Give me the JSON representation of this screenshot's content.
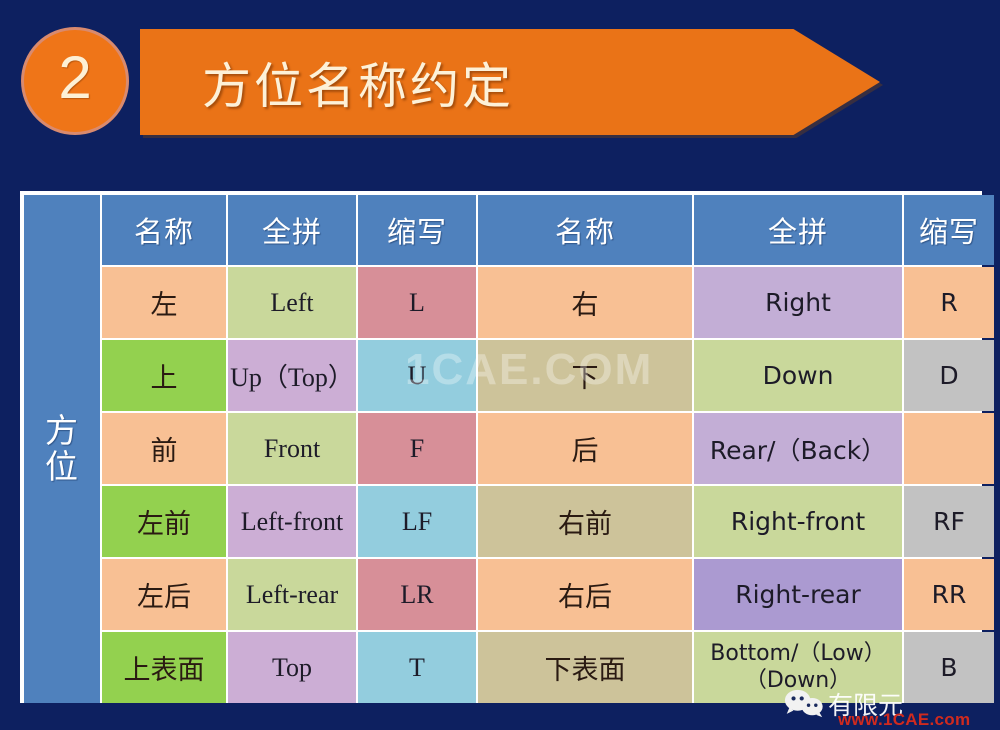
{
  "slide": {
    "background_color": "#0d2060",
    "badge_number": "2",
    "badge_color": "#ef7518",
    "banner_title": "方位名称约定",
    "banner_color": "#ea7317",
    "title_color": "#fdf1d8"
  },
  "table": {
    "row_label": "方位",
    "header_color": "#4f81bd",
    "headers": [
      "名称",
      "全拼",
      "缩写",
      "名称",
      "全拼",
      "缩写"
    ],
    "rows": [
      {
        "left_name": "左",
        "left_full": "Left",
        "left_abbr": "L",
        "right_name": "右",
        "right_full": "Right",
        "right_abbr": "R"
      },
      {
        "left_name": "上",
        "left_full": "Up（Top）",
        "left_abbr": "U",
        "right_name": "下",
        "right_full": "Down",
        "right_abbr": "D"
      },
      {
        "left_name": "前",
        "left_full": "Front",
        "left_abbr": "F",
        "right_name": "后",
        "right_full": "Rear/（Back）",
        "right_abbr": ""
      },
      {
        "left_name": "左前",
        "left_full": "Left-front",
        "left_abbr": "LF",
        "right_name": "右前",
        "right_full": "Right-front",
        "right_abbr": "RF"
      },
      {
        "left_name": "左后",
        "left_full": "Left-rear",
        "left_abbr": "LR",
        "right_name": "右后",
        "right_full": "Right-rear",
        "right_abbr": "RR"
      },
      {
        "left_name": "上表面",
        "left_full": "Top",
        "left_abbr": "T",
        "right_name": "下表面",
        "right_full": "Bottom/（Low）（Down）",
        "right_abbr": "B"
      }
    ]
  },
  "watermarks": {
    "center": "1CAE.COM",
    "corner_text": "有限元",
    "corner_url": "www.1CAE.com"
  }
}
